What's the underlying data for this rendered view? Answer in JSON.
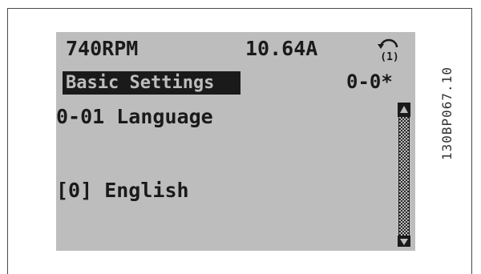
{
  "display": {
    "status": {
      "speed": "740RPM",
      "current": "10.64A",
      "menu_icon_label": "(1)"
    },
    "menu": {
      "title": "Basic Settings",
      "code": "0-0*"
    },
    "parameter": {
      "name": "0-01 Language",
      "value": "[0] English"
    },
    "scrollbar": {
      "up_icon": "scroll-up-arrow",
      "down_icon": "scroll-down-arrow"
    }
  },
  "figure_id": "130BP067.10",
  "colors": {
    "lcd_background": "#bdbdbd",
    "lcd_text": "#1a1a1a"
  }
}
